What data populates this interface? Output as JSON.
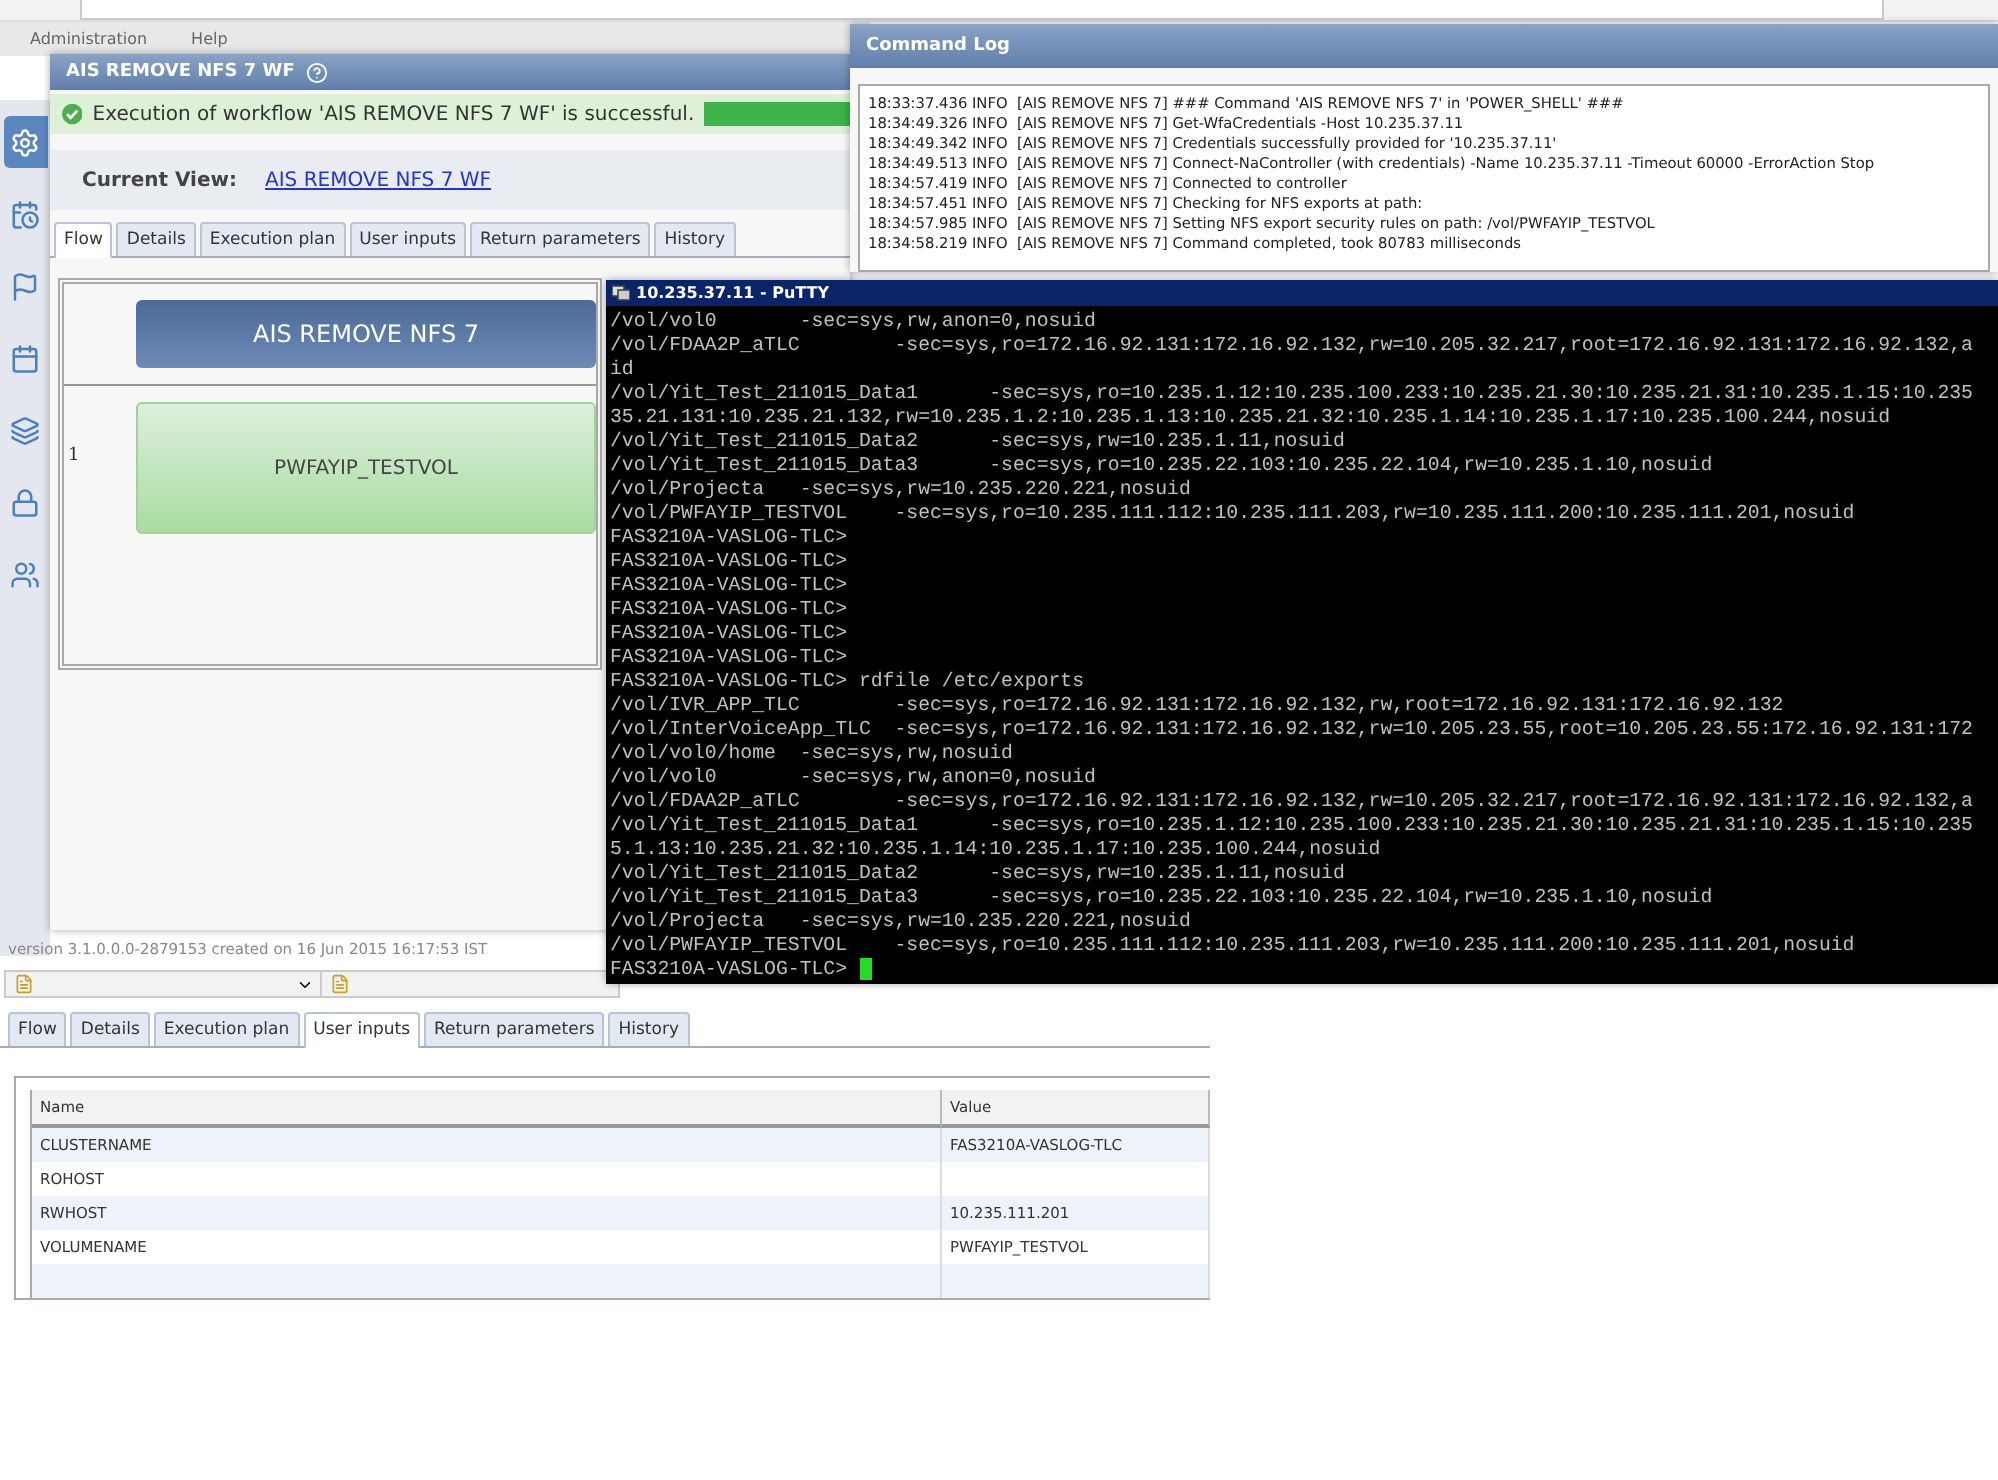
{
  "menu": [
    "Administration",
    "Help"
  ],
  "sidebar": {
    "items": [
      {
        "selected": true
      },
      {
        "selected": false
      },
      {
        "selected": false
      },
      {
        "selected": false
      },
      {
        "selected": false
      },
      {
        "selected": false
      },
      {
        "selected": false
      }
    ]
  },
  "workflow_dialog": {
    "title": "AIS REMOVE NFS 7 WF",
    "status_message": "Execution of workflow 'AIS REMOVE NFS 7 WF' is successful.",
    "progress": {
      "level": 1
    },
    "current_view_label": "Current View:",
    "current_view_link": "AIS REMOVE NFS 7 WF",
    "tabs": [
      {
        "label": "Flow",
        "selected": true
      },
      {
        "label": "Details",
        "selected": false
      },
      {
        "label": "Execution plan",
        "selected": false
      },
      {
        "label": "User inputs",
        "selected": false
      },
      {
        "label": "Return parameters",
        "selected": false
      },
      {
        "label": "History",
        "selected": false
      }
    ],
    "flow": {
      "header": "AIS REMOVE NFS 7",
      "row_number": "1",
      "step": "PWFAYIP_TESTVOL"
    }
  },
  "version": "version 3.1.0.0.0-2879153 created on 16 Jun 2015 16:17:53 IST",
  "command_log": {
    "title": "Command Log",
    "lines": [
      "18:33:37.436 INFO  [AIS REMOVE NFS 7] ### Command 'AIS REMOVE NFS 7' in 'POWER_SHELL' ###",
      "18:34:49.326 INFO  [AIS REMOVE NFS 7] Get-WfaCredentials -Host 10.235.37.11",
      "18:34:49.342 INFO  [AIS REMOVE NFS 7] Credentials successfully provided for '10.235.37.11'",
      "18:34:49.513 INFO  [AIS REMOVE NFS 7] Connect-NaController (with credentials) -Name 10.235.37.11 -Timeout 60000 -ErrorAction Stop",
      "18:34:57.419 INFO  [AIS REMOVE NFS 7] Connected to controller",
      "18:34:57.451 INFO  [AIS REMOVE NFS 7] Checking for NFS exports at path:",
      "18:34:57.985 INFO  [AIS REMOVE NFS 7] Setting NFS export security rules on path: /vol/PWFAYIP_TESTVOL",
      "18:34:58.219 INFO  [AIS REMOVE NFS 7] Command completed, took 80783 milliseconds"
    ]
  },
  "putty": {
    "title": "10.235.37.11 - PuTTY",
    "lines": [
      "/vol/vol0       -sec=sys,rw,anon=0,nosuid",
      "/vol/FDAA2P_aTLC        -sec=sys,ro=172.16.92.131:172.16.92.132,rw=10.205.32.217,root=172.16.92.131:172.16.92.132,a",
      "id",
      "/vol/Yit_Test_211015_Data1      -sec=sys,ro=10.235.1.12:10.235.100.233:10.235.21.30:10.235.21.31:10.235.1.15:10.235",
      "35.21.131:10.235.21.132,rw=10.235.1.2:10.235.1.13:10.235.21.32:10.235.1.14:10.235.1.17:10.235.100.244,nosuid",
      "/vol/Yit_Test_211015_Data2      -sec=sys,rw=10.235.1.11,nosuid",
      "/vol/Yit_Test_211015_Data3      -sec=sys,ro=10.235.22.103:10.235.22.104,rw=10.235.1.10,nosuid",
      "/vol/Projecta   -sec=sys,rw=10.235.220.221,nosuid",
      "/vol/PWFAYIP_TESTVOL    -sec=sys,ro=10.235.111.112:10.235.111.203,rw=10.235.111.200:10.235.111.201,nosuid",
      "FAS3210A-VASLOG-TLC>",
      "FAS3210A-VASLOG-TLC>",
      "FAS3210A-VASLOG-TLC>",
      "FAS3210A-VASLOG-TLC>",
      "FAS3210A-VASLOG-TLC>",
      "FAS3210A-VASLOG-TLC>",
      "FAS3210A-VASLOG-TLC> rdfile /etc/exports",
      "/vol/IVR_APP_TLC        -sec=sys,ro=172.16.92.131:172.16.92.132,rw,root=172.16.92.131:172.16.92.132",
      "/vol/InterVoiceApp_TLC  -sec=sys,ro=172.16.92.131:172.16.92.132,rw=10.205.23.55,root=10.205.23.55:172.16.92.131:172",
      "/vol/vol0/home  -sec=sys,rw,nosuid",
      "/vol/vol0       -sec=sys,rw,anon=0,nosuid",
      "/vol/FDAA2P_aTLC        -sec=sys,ro=172.16.92.131:172.16.92.132,rw=10.205.32.217,root=172.16.92.131:172.16.92.132,a",
      "/vol/Yit_Test_211015_Data1      -sec=sys,ro=10.235.1.12:10.235.100.233:10.235.21.30:10.235.21.31:10.235.1.15:10.235",
      "5.1.13:10.235.21.32:10.235.1.14:10.235.1.17:10.235.100.244,nosuid",
      "/vol/Yit_Test_211015_Data2      -sec=sys,rw=10.235.1.11,nosuid",
      "/vol/Yit_Test_211015_Data3      -sec=sys,ro=10.235.22.103:10.235.22.104,rw=10.235.1.10,nosuid",
      "/vol/Projecta   -sec=sys,rw=10.235.220.221,nosuid",
      "/vol/PWFAYIP_TESTVOL    -sec=sys,ro=10.235.111.112:10.235.111.203,rw=10.235.111.200:10.235.111.201,nosuid",
      "FAS3210A-VASLOG-TLC>"
    ]
  },
  "details_panel": {
    "tabs": [
      {
        "label": "Flow",
        "selected": false
      },
      {
        "label": "Details",
        "selected": false
      },
      {
        "label": "Execution plan",
        "selected": false
      },
      {
        "label": "User inputs",
        "selected": true
      },
      {
        "label": "Return parameters",
        "selected": false
      },
      {
        "label": "History",
        "selected": false
      }
    ],
    "table": {
      "columns": [
        "Name",
        "Value"
      ],
      "rows": [
        {
          "name": "CLUSTERNAME",
          "value": "FAS3210A-VASLOG-TLC"
        },
        {
          "name": "ROHOST",
          "value": ""
        },
        {
          "name": "RWHOST",
          "value": "10.235.111.201"
        },
        {
          "name": "VOLUMENAME",
          "value": "PWFAYIP_TESTVOL"
        }
      ]
    }
  }
}
